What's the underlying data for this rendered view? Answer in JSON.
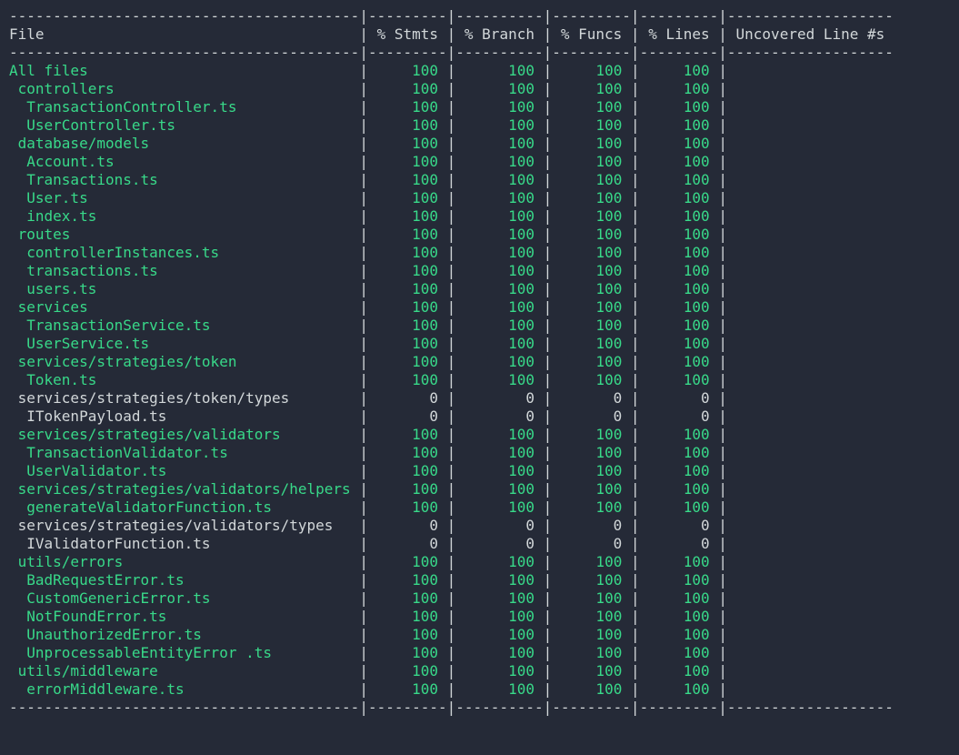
{
  "columns": {
    "file": "File",
    "stmts": "% Stmts",
    "branch": "% Branch",
    "funcs": "% Funcs",
    "lines": "% Lines",
    "uncovered": "Uncovered Line #s"
  },
  "rows": [
    {
      "name": "All files",
      "indent": 0,
      "stmts": "100",
      "branch": "100",
      "funcs": "100",
      "lines": "100",
      "uncovered": "",
      "covered": true
    },
    {
      "name": "controllers",
      "indent": 1,
      "stmts": "100",
      "branch": "100",
      "funcs": "100",
      "lines": "100",
      "uncovered": "",
      "covered": true
    },
    {
      "name": "TransactionController.ts",
      "indent": 2,
      "stmts": "100",
      "branch": "100",
      "funcs": "100",
      "lines": "100",
      "uncovered": "",
      "covered": true
    },
    {
      "name": "UserController.ts",
      "indent": 2,
      "stmts": "100",
      "branch": "100",
      "funcs": "100",
      "lines": "100",
      "uncovered": "",
      "covered": true
    },
    {
      "name": "database/models",
      "indent": 1,
      "stmts": "100",
      "branch": "100",
      "funcs": "100",
      "lines": "100",
      "uncovered": "",
      "covered": true
    },
    {
      "name": "Account.ts",
      "indent": 2,
      "stmts": "100",
      "branch": "100",
      "funcs": "100",
      "lines": "100",
      "uncovered": "",
      "covered": true
    },
    {
      "name": "Transactions.ts",
      "indent": 2,
      "stmts": "100",
      "branch": "100",
      "funcs": "100",
      "lines": "100",
      "uncovered": "",
      "covered": true
    },
    {
      "name": "User.ts",
      "indent": 2,
      "stmts": "100",
      "branch": "100",
      "funcs": "100",
      "lines": "100",
      "uncovered": "",
      "covered": true
    },
    {
      "name": "index.ts",
      "indent": 2,
      "stmts": "100",
      "branch": "100",
      "funcs": "100",
      "lines": "100",
      "uncovered": "",
      "covered": true
    },
    {
      "name": "routes",
      "indent": 1,
      "stmts": "100",
      "branch": "100",
      "funcs": "100",
      "lines": "100",
      "uncovered": "",
      "covered": true
    },
    {
      "name": "controllerInstances.ts",
      "indent": 2,
      "stmts": "100",
      "branch": "100",
      "funcs": "100",
      "lines": "100",
      "uncovered": "",
      "covered": true
    },
    {
      "name": "transactions.ts",
      "indent": 2,
      "stmts": "100",
      "branch": "100",
      "funcs": "100",
      "lines": "100",
      "uncovered": "",
      "covered": true
    },
    {
      "name": "users.ts",
      "indent": 2,
      "stmts": "100",
      "branch": "100",
      "funcs": "100",
      "lines": "100",
      "uncovered": "",
      "covered": true
    },
    {
      "name": "services",
      "indent": 1,
      "stmts": "100",
      "branch": "100",
      "funcs": "100",
      "lines": "100",
      "uncovered": "",
      "covered": true
    },
    {
      "name": "TransactionService.ts",
      "indent": 2,
      "stmts": "100",
      "branch": "100",
      "funcs": "100",
      "lines": "100",
      "uncovered": "",
      "covered": true
    },
    {
      "name": "UserService.ts",
      "indent": 2,
      "stmts": "100",
      "branch": "100",
      "funcs": "100",
      "lines": "100",
      "uncovered": "",
      "covered": true
    },
    {
      "name": "services/strategies/token",
      "indent": 1,
      "stmts": "100",
      "branch": "100",
      "funcs": "100",
      "lines": "100",
      "uncovered": "",
      "covered": true
    },
    {
      "name": "Token.ts",
      "indent": 2,
      "stmts": "100",
      "branch": "100",
      "funcs": "100",
      "lines": "100",
      "uncovered": "",
      "covered": true
    },
    {
      "name": "services/strategies/token/types",
      "indent": 1,
      "stmts": "0",
      "branch": "0",
      "funcs": "0",
      "lines": "0",
      "uncovered": "",
      "covered": false
    },
    {
      "name": "ITokenPayload.ts",
      "indent": 2,
      "stmts": "0",
      "branch": "0",
      "funcs": "0",
      "lines": "0",
      "uncovered": "",
      "covered": false
    },
    {
      "name": "services/strategies/validators",
      "indent": 1,
      "stmts": "100",
      "branch": "100",
      "funcs": "100",
      "lines": "100",
      "uncovered": "",
      "covered": true
    },
    {
      "name": "TransactionValidator.ts",
      "indent": 2,
      "stmts": "100",
      "branch": "100",
      "funcs": "100",
      "lines": "100",
      "uncovered": "",
      "covered": true
    },
    {
      "name": "UserValidator.ts",
      "indent": 2,
      "stmts": "100",
      "branch": "100",
      "funcs": "100",
      "lines": "100",
      "uncovered": "",
      "covered": true
    },
    {
      "name": "services/strategies/validators/helpers",
      "indent": 1,
      "stmts": "100",
      "branch": "100",
      "funcs": "100",
      "lines": "100",
      "uncovered": "",
      "covered": true
    },
    {
      "name": "generateValidatorFunction.ts",
      "indent": 2,
      "stmts": "100",
      "branch": "100",
      "funcs": "100",
      "lines": "100",
      "uncovered": "",
      "covered": true
    },
    {
      "name": "services/strategies/validators/types",
      "indent": 1,
      "stmts": "0",
      "branch": "0",
      "funcs": "0",
      "lines": "0",
      "uncovered": "",
      "covered": false
    },
    {
      "name": "IValidatorFunction.ts",
      "indent": 2,
      "stmts": "0",
      "branch": "0",
      "funcs": "0",
      "lines": "0",
      "uncovered": "",
      "covered": false
    },
    {
      "name": "utils/errors",
      "indent": 1,
      "stmts": "100",
      "branch": "100",
      "funcs": "100",
      "lines": "100",
      "uncovered": "",
      "covered": true
    },
    {
      "name": "BadRequestError.ts",
      "indent": 2,
      "stmts": "100",
      "branch": "100",
      "funcs": "100",
      "lines": "100",
      "uncovered": "",
      "covered": true
    },
    {
      "name": "CustomGenericError.ts",
      "indent": 2,
      "stmts": "100",
      "branch": "100",
      "funcs": "100",
      "lines": "100",
      "uncovered": "",
      "covered": true
    },
    {
      "name": "NotFoundError.ts",
      "indent": 2,
      "stmts": "100",
      "branch": "100",
      "funcs": "100",
      "lines": "100",
      "uncovered": "",
      "covered": true
    },
    {
      "name": "UnauthorizedError.ts",
      "indent": 2,
      "stmts": "100",
      "branch": "100",
      "funcs": "100",
      "lines": "100",
      "uncovered": "",
      "covered": true
    },
    {
      "name": "UnprocessableEntityError .ts",
      "indent": 2,
      "stmts": "100",
      "branch": "100",
      "funcs": "100",
      "lines": "100",
      "uncovered": "",
      "covered": true
    },
    {
      "name": "utils/middleware",
      "indent": 1,
      "stmts": "100",
      "branch": "100",
      "funcs": "100",
      "lines": "100",
      "uncovered": "",
      "covered": true
    },
    {
      "name": "errorMiddleware.ts",
      "indent": 2,
      "stmts": "100",
      "branch": "100",
      "funcs": "100",
      "lines": "100",
      "uncovered": "",
      "covered": true
    }
  ],
  "widths": {
    "file": 40,
    "stmts": 9,
    "branch": 10,
    "funcs": 9,
    "lines": 9,
    "uncovered": 19
  }
}
